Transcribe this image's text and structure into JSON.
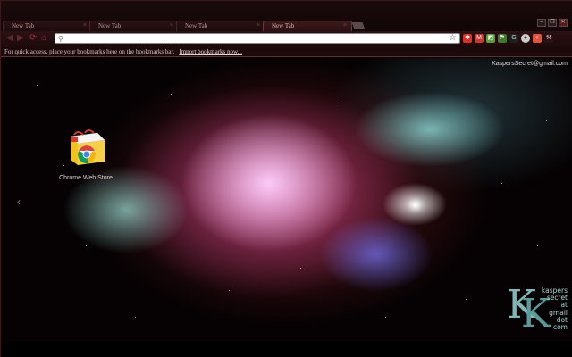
{
  "tabs": [
    {
      "label": "New Tab",
      "active": false
    },
    {
      "label": "New Tab",
      "active": false
    },
    {
      "label": "New Tab",
      "active": false
    },
    {
      "label": "New Tab",
      "active": true
    }
  ],
  "window_controls": [
    "minimize",
    "restore",
    "close"
  ],
  "omnibox": {
    "value": "",
    "placeholder": ""
  },
  "extensions": [
    {
      "icon": "puzzle-icon",
      "color": "#d9322b"
    },
    {
      "icon": "gmail-icon",
      "color": "#c8372d"
    },
    {
      "icon": "evernote-icon",
      "color": "#5c9e3a"
    },
    {
      "icon": "flag-icon",
      "color": "#3d7a2a"
    },
    {
      "icon": "google-g-icon",
      "color": "#1f1f1f"
    },
    {
      "icon": "circle-icon",
      "color": "#cccccc"
    },
    {
      "icon": "plus-icon",
      "color": "#e0533c"
    },
    {
      "icon": "wrench-icon",
      "color": "#2b1113"
    }
  ],
  "bookmarks_bar": {
    "message": "For quick access, place your bookmarks here on the bookmarks bar.",
    "import_link": "Import bookmarks now..."
  },
  "user": {
    "name": "KaspersSecret@gmail.com"
  },
  "apps": [
    {
      "label": "Chrome Web Store"
    }
  ],
  "logo": {
    "letters": "KK",
    "lines": [
      "kaspers",
      "secret",
      "at",
      "gmail",
      "dot",
      "com"
    ]
  },
  "colors": {
    "frame": "#1a0a0b",
    "accent": "#a0353a",
    "teal": "#7fb8b6"
  }
}
